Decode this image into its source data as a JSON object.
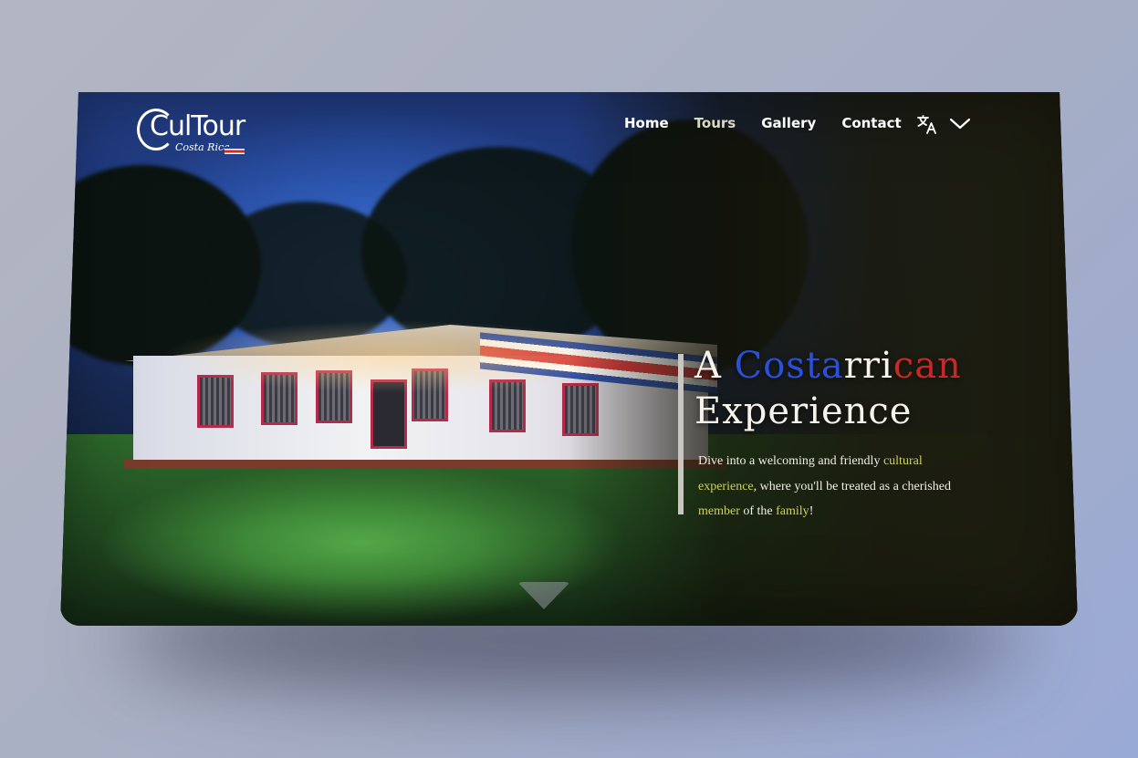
{
  "brand": {
    "logo_text": "CulTour",
    "logo_sub": "Costa Rica"
  },
  "nav": {
    "items": [
      {
        "label": "Home",
        "active": false
      },
      {
        "label": "Tours",
        "active": true
      },
      {
        "label": "Gallery",
        "active": false
      },
      {
        "label": "Contact",
        "active": false
      }
    ],
    "language_icon": "translate-icon",
    "dropdown_icon": "chevron-down-icon"
  },
  "hero": {
    "title_line1_parts": [
      "A ",
      "Costa",
      "rri",
      "can"
    ],
    "title_line2": "Experience",
    "body_parts": [
      "Dive into a welcoming and friendly ",
      "cultural experience",
      ", where you'll be treated as a cherished ",
      "member",
      " of the ",
      "family",
      "!"
    ],
    "scroll_icon": "scroll-down-arrow-icon"
  },
  "colors": {
    "accent_blue": "#2b4fd8",
    "accent_red": "#c82828",
    "highlight": "#cfd35a",
    "page_background": "#a7aec4"
  }
}
